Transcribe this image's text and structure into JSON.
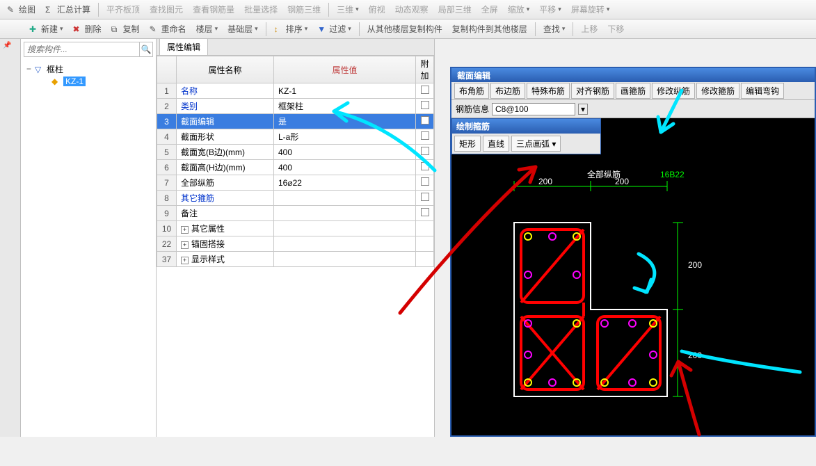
{
  "toolbar1": {
    "draw": "绘图",
    "sum": "汇总计算",
    "align": "平齐板顶",
    "find": "查找图元",
    "rebar": "查看钢筋量",
    "batch": "批量选择",
    "rebar3d": "钢筋三维",
    "view3d": "三维",
    "persp": "俯视",
    "dyn": "动态观察",
    "local3d": "局部三维",
    "full": "全屏",
    "zoom": "缩放",
    "pan": "平移",
    "rotate": "屏幕旋转"
  },
  "toolbar2": {
    "new": "新建",
    "del": "删除",
    "copy": "复制",
    "rename": "重命名",
    "floor": "楼层",
    "basefloor": "基础层",
    "sort": "排序",
    "filter": "过滤",
    "copyfrom": "从其他楼层复制构件",
    "copyto": "复制构件到其他楼层",
    "search": "查找",
    "up": "上移",
    "down": "下移"
  },
  "searchPlaceholder": "搜索构件...",
  "tree": {
    "root": "框柱",
    "child": "KZ-1"
  },
  "tabs": {
    "prop": "属性编辑"
  },
  "propHeaders": {
    "name": "属性名称",
    "value": "属性值",
    "extra": "附加"
  },
  "props": [
    {
      "idx": "1",
      "name": "名称",
      "val": "KZ-1",
      "link": true,
      "chk": false
    },
    {
      "idx": "2",
      "name": "类别",
      "val": "框架柱",
      "link": true,
      "chk": true
    },
    {
      "idx": "3",
      "name": "截面编辑",
      "val": "是",
      "link": false,
      "sel": true,
      "chk": false
    },
    {
      "idx": "4",
      "name": "截面形状",
      "val": "L-a形",
      "link": false,
      "chk": true
    },
    {
      "idx": "5",
      "name": "截面宽(B边)(mm)",
      "val": "400",
      "link": false,
      "chk": true
    },
    {
      "idx": "6",
      "name": "截面高(H边)(mm)",
      "val": "400",
      "link": false,
      "chk": true
    },
    {
      "idx": "7",
      "name": "全部纵筋",
      "val": "16⌀22",
      "link": false,
      "chk": true
    },
    {
      "idx": "8",
      "name": "其它箍筋",
      "val": "",
      "link": true,
      "chk": true
    },
    {
      "idx": "9",
      "name": "备注",
      "val": "",
      "link": false,
      "chk": true
    },
    {
      "idx": "10",
      "name": "其它属性",
      "val": "",
      "plus": true
    },
    {
      "idx": "22",
      "name": "锚固搭接",
      "val": "",
      "plus": true
    },
    {
      "idx": "37",
      "name": "显示样式",
      "val": "",
      "plus": true
    }
  ],
  "section": {
    "title": "截面编辑",
    "buttons": [
      "布角筋",
      "布边筋",
      "特殊布筋",
      "对齐钢筋",
      "画箍筋",
      "修改纵筋",
      "修改箍筋",
      "编辑弯钩"
    ],
    "infoLabel": "钢筋信息",
    "infoValue": "C8@100",
    "floatTitle": "绘制箍筋",
    "floatButtons": [
      "矩形",
      "直线",
      "三点画弧"
    ],
    "dims": {
      "top1": "200",
      "top2": "200",
      "right1": "200",
      "right2": "200"
    },
    "annot": {
      "label": "全部纵筋",
      "value": "16B22"
    }
  }
}
